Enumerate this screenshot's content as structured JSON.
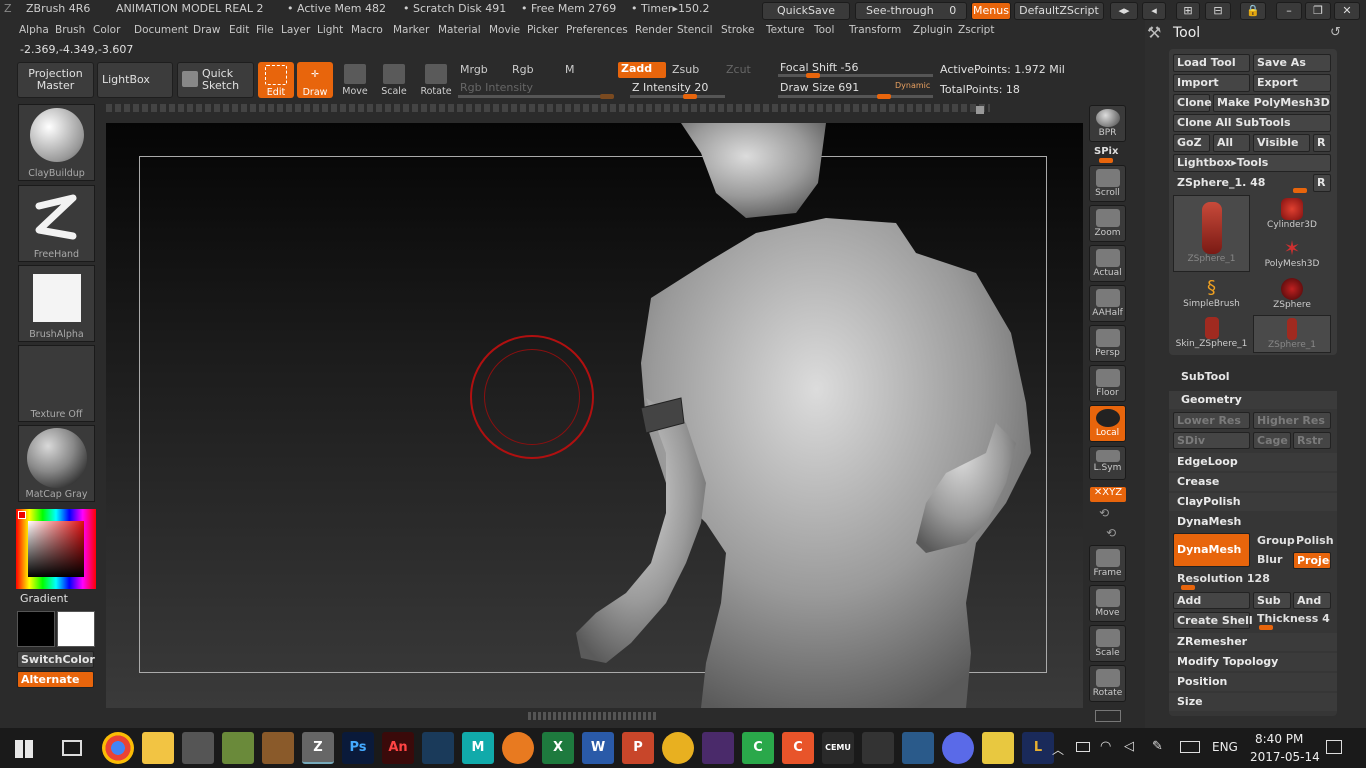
{
  "titlebar": {
    "app": "ZBrush 4R6",
    "document": "ANIMATION MODEL REAL 2",
    "active_mem": "• Active Mem 482",
    "scratch_disk": "• Scratch Disk 491",
    "free_mem": "• Free Mem 2769",
    "timer": "• Timer▸150.2",
    "quicksave": "QuickSave",
    "see_through": "See-through",
    "see_through_value": "0",
    "menus": "Menus",
    "default_zscript": "DefaultZScript"
  },
  "menu": [
    "Alpha",
    "Brush",
    "Color",
    "Document",
    "Draw",
    "Edit",
    "File",
    "Layer",
    "Light",
    "Macro",
    "Marker",
    "Material",
    "Movie",
    "Picker",
    "Preferences",
    "Render",
    "Stencil",
    "Stroke",
    "Texture",
    "Tool",
    "Transform",
    "Zplugin",
    "Zscript"
  ],
  "coords": "-2.369,-4.349,-3.607",
  "toolbar": {
    "projection_master": "Projection Master",
    "lightbox": "LightBox",
    "quick_sketch": "Quick Sketch",
    "edit": "Edit",
    "draw": "Draw",
    "move": "Move",
    "scale": "Scale",
    "rotate": "Rotate",
    "mrgb": "Mrgb",
    "rgb": "Rgb",
    "m": "M",
    "zadd": "Zadd",
    "zsub": "Zsub",
    "zcut": "Zcut",
    "rgb_intensity": "Rgb Intensity",
    "z_intensity": "Z Intensity 20",
    "focal_shift": "Focal Shift -56",
    "draw_size": "Draw Size 691",
    "dynamic": "Dynamic",
    "active_points": "ActivePoints: 1.972 Mil",
    "total_points": "TotalPoints: 18"
  },
  "left_shelf": {
    "brush": "ClayBuildup",
    "stroke": "FreeHand",
    "alpha": "BrushAlpha",
    "texture": "Texture Off",
    "material": "MatCap Gray",
    "gradient": "Gradient",
    "switch_color": "SwitchColor",
    "alternate": "Alternate"
  },
  "right_shelf": {
    "bpr": "BPR",
    "spix": "SPix",
    "scroll": "Scroll",
    "zoom": "Zoom",
    "actual": "Actual",
    "aahalf": "AAHalf",
    "persp": "Persp",
    "floor": "Floor",
    "local": "Local",
    "lsym": "L.Sym",
    "xyz": "✕XYZ",
    "frame": "Frame",
    "move": "Move",
    "scale": "Scale",
    "rotate": "Rotate"
  },
  "tool_panel": {
    "title": "Tool",
    "load_tool": "Load Tool",
    "save_as": "Save As",
    "import": "Import",
    "export": "Export",
    "clone": "Clone",
    "make_polymesh": "Make PolyMesh3D",
    "clone_all": "Clone All SubTools",
    "goz": "GoZ",
    "all": "All",
    "visible": "Visible",
    "r": "R",
    "lightbox_tools": "Lightbox▸Tools",
    "current_tool": "ZSphere_1. 48",
    "thumbs": [
      "ZSphere_1",
      "Cylinder3D",
      "PolyMesh3D",
      "SimpleBrush",
      "ZSphere",
      "Skin_ZSphere_1",
      "ZSphere_1"
    ],
    "subtool": "SubTool",
    "geometry": "Geometry",
    "lower_res": "Lower Res",
    "higher_res": "Higher Res",
    "sdiv": "SDiv",
    "cage": "Cage",
    "rstr": "Rstr",
    "edgeloop": "EdgeLoop",
    "crease": "Crease",
    "claypolish": "ClayPolish",
    "dynamesh_head": "DynaMesh",
    "dynamesh_btn": "DynaMesh",
    "group": "Group",
    "polish": "Polish",
    "blur": "Blur",
    "project": "Projec",
    "resolution": "Resolution 128",
    "add": "Add",
    "sub": "Sub",
    "and": "And",
    "create_shell": "Create Shell",
    "thickness": "Thickness 4",
    "zremesher": "ZRemesher",
    "modify_topology": "Modify Topology",
    "position": "Position",
    "size": "Size"
  },
  "taskbar": {
    "apps": [
      "Chrome",
      "Explorer",
      "Media",
      "App",
      "App",
      "ZBrush",
      "Ps",
      "An",
      "App",
      "Maya",
      "Blender",
      "Excel",
      "Word",
      "PowerPoint",
      "App",
      "App",
      "Camtasia",
      "App",
      "Cemu",
      "App",
      "App",
      "Discord",
      "App",
      "App"
    ],
    "lang": "ENG",
    "time": "8:40 PM",
    "date": "2017-05-14"
  }
}
